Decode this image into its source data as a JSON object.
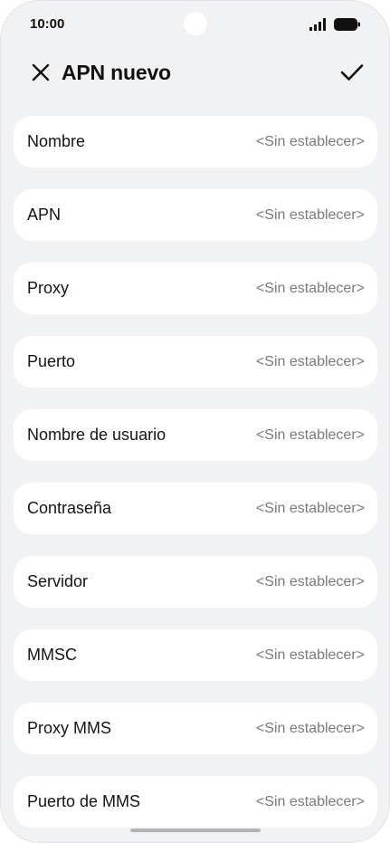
{
  "status_bar": {
    "time": "10:00",
    "icons": [
      "signal-icon",
      "battery-icon"
    ]
  },
  "header": {
    "title": "APN nuevo",
    "close_icon": "close-icon",
    "confirm_icon": "checkmark-icon"
  },
  "fields": [
    {
      "label": "Nombre",
      "value": "<Sin establecer>"
    },
    {
      "label": "APN",
      "value": "<Sin establecer>"
    },
    {
      "label": "Proxy",
      "value": "<Sin establecer>"
    },
    {
      "label": "Puerto",
      "value": "<Sin establecer>"
    },
    {
      "label": "Nombre de usuario",
      "value": "<Sin establecer>"
    },
    {
      "label": "Contraseña",
      "value": "<Sin establecer>"
    },
    {
      "label": "Servidor",
      "value": "<Sin establecer>"
    },
    {
      "label": "MMSC",
      "value": "<Sin establecer>"
    },
    {
      "label": "Proxy MMS",
      "value": "<Sin establecer>"
    },
    {
      "label": "Puerto de MMS",
      "value": "<Sin establecer>"
    }
  ],
  "colors": {
    "background": "#f1f2f4",
    "card": "#ffffff",
    "label": "#141414",
    "value": "#7a7a7e"
  }
}
